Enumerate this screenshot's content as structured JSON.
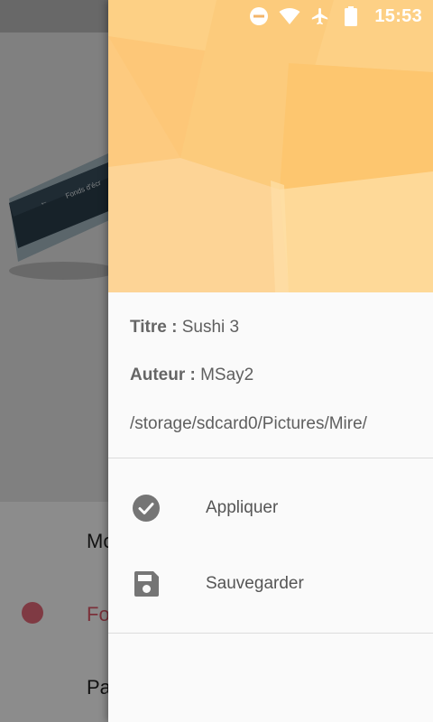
{
  "status_bar": {
    "time": "15:53",
    "icons": [
      "do-not-disturb-icon",
      "wifi-icon",
      "airplane-mode-icon",
      "battery-icon"
    ]
  },
  "background_app": {
    "preview_caption": "Fonds d'écr",
    "rows": [
      "Mo",
      "Fo",
      "Pa"
    ]
  },
  "drawer": {
    "info": {
      "title_label": "Titre :",
      "title_value": "Sushi 3",
      "author_label": "Auteur :",
      "author_value": "MSay2",
      "path": "/storage/sdcard0/Pictures/Mire/"
    },
    "menu": [
      {
        "label": "Appliquer",
        "icon": "check-circle-icon"
      },
      {
        "label": "Sauvegarder",
        "icon": "save-icon"
      }
    ]
  },
  "colors": {
    "header_base": "#fdc778",
    "scrim": "rgba(0,0,0,0.45)",
    "icon_gray": "#757575",
    "accent_dot": "#e86b7b"
  }
}
